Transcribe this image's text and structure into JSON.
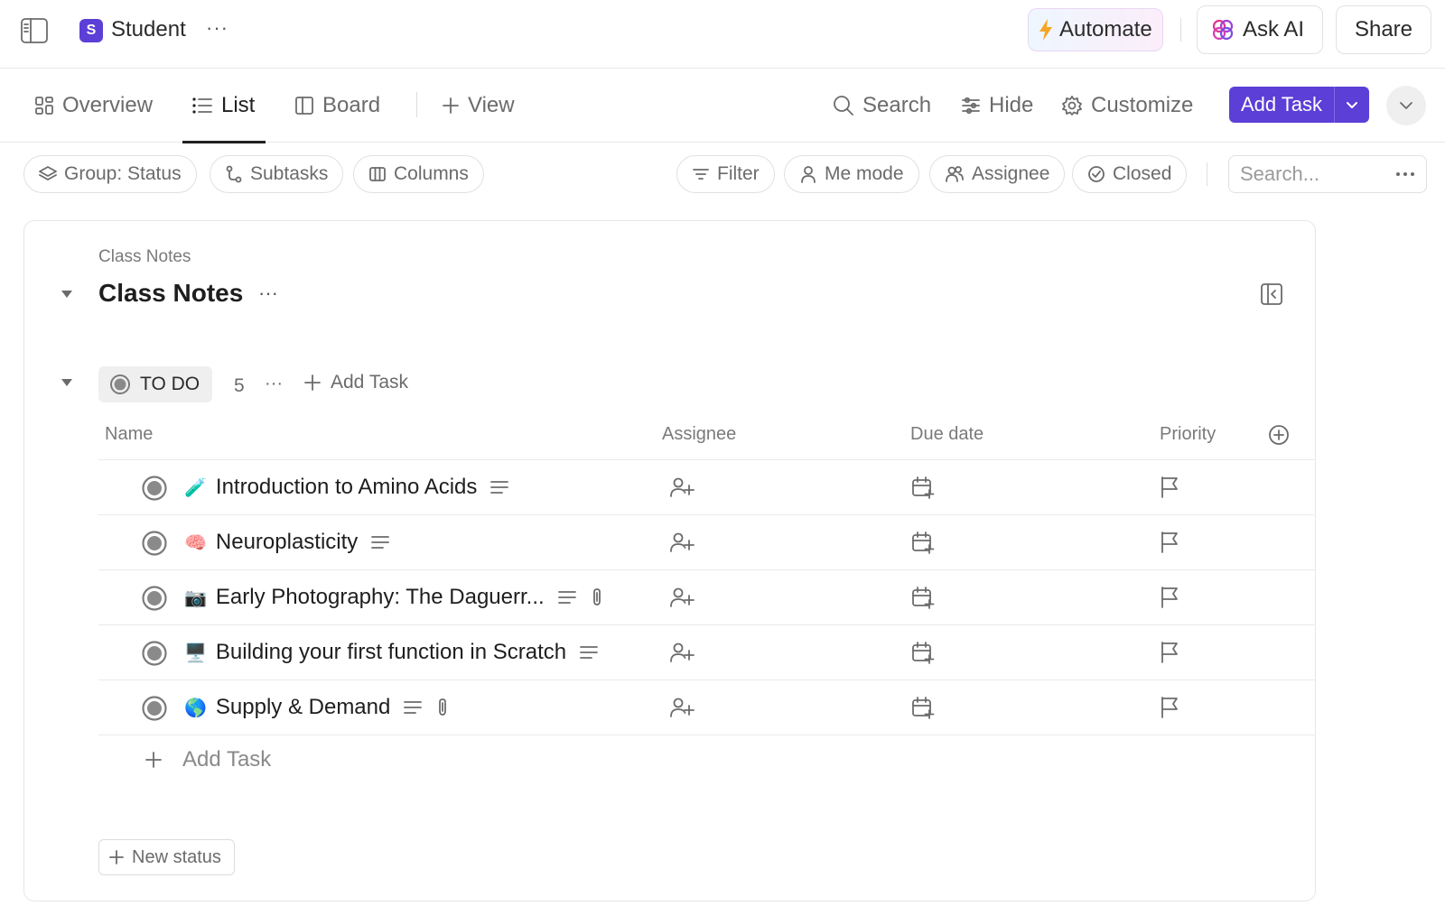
{
  "header": {
    "space_initial": "S",
    "space_name": "Student",
    "more": "···",
    "automate_label": "Automate",
    "ask_ai_label": "Ask AI",
    "share_label": "Share"
  },
  "views": {
    "tabs": [
      {
        "label": "Overview",
        "icon": "overview-icon"
      },
      {
        "label": "List",
        "icon": "list-icon",
        "active": true
      },
      {
        "label": "Board",
        "icon": "board-icon"
      }
    ],
    "add_view_label": "View",
    "search_label": "Search",
    "hide_label": "Hide",
    "customize_label": "Customize",
    "add_task_label": "Add Task"
  },
  "filters": {
    "group_label": "Group: Status",
    "subtasks_label": "Subtasks",
    "columns_label": "Columns",
    "filter_label": "Filter",
    "me_mode_label": "Me mode",
    "assignee_label": "Assignee",
    "closed_label": "Closed",
    "search_placeholder": "Search..."
  },
  "list": {
    "breadcrumb": "Class Notes",
    "title": "Class Notes",
    "more": "···"
  },
  "group": {
    "status": "TO DO",
    "count": "5",
    "more": "···",
    "add_task_label": "Add Task"
  },
  "columns": {
    "name": "Name",
    "assignee": "Assignee",
    "due_date": "Due date",
    "priority": "Priority"
  },
  "tasks": [
    {
      "emoji": "🧪",
      "title": "Introduction to Amino Acids",
      "has_description": true,
      "has_attachment": false
    },
    {
      "emoji": "🧠",
      "title": "Neuroplasticity",
      "has_description": true,
      "has_attachment": false
    },
    {
      "emoji": "📷",
      "title": "Early Photography: The Daguerr...",
      "has_description": true,
      "has_attachment": true
    },
    {
      "emoji": "🖥️",
      "title": "Building your first function in Scratch",
      "has_description": true,
      "has_attachment": false
    },
    {
      "emoji": "🌎",
      "title": "Supply & Demand",
      "has_description": true,
      "has_attachment": true
    }
  ],
  "add_task_row_label": "Add Task",
  "new_status_label": "New status",
  "colors": {
    "accent": "#5b3fd6",
    "text": "#1e1e1e",
    "muted": "#6b6b6b",
    "border": "#e6e6e6"
  }
}
